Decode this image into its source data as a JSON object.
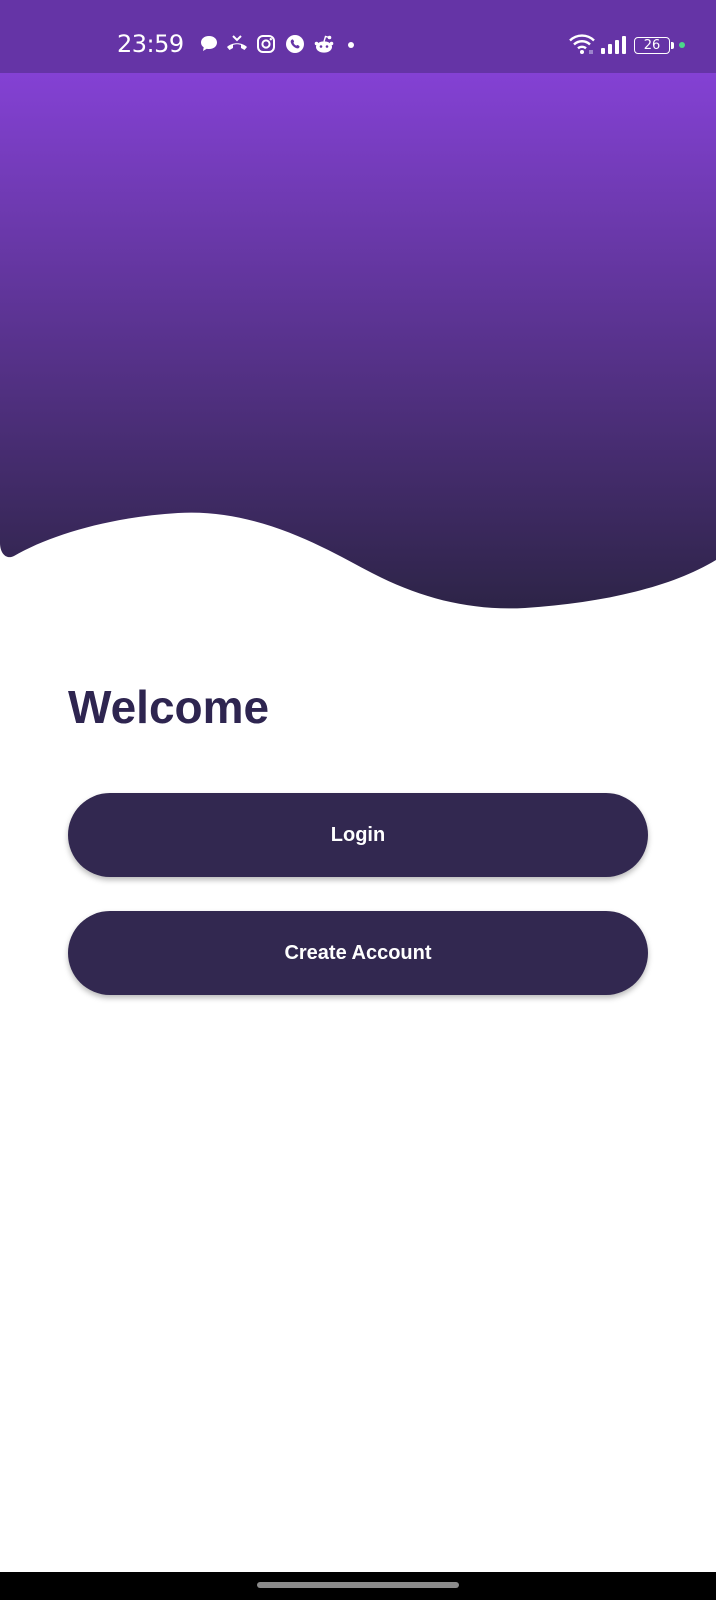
{
  "status_bar": {
    "time": "23:59",
    "battery_level": "26",
    "notification_icons": [
      "chat-bubble-icon",
      "missed-call-icon",
      "instagram-icon",
      "viber-icon",
      "reddit-icon",
      "more-dot-icon"
    ],
    "system_icons": [
      "wifi-icon",
      "signal-icon",
      "battery-icon",
      "charging-dot-icon"
    ]
  },
  "header": {
    "gradient_top": "#8441d4",
    "gradient_bottom": "#2d2447"
  },
  "main": {
    "title": "Welcome",
    "login_label": "Login",
    "create_account_label": "Create Account"
  },
  "colors": {
    "status_bar": "#6534a6",
    "button": "#322850",
    "title": "#2e2550",
    "charging_dot": "#4cd88a"
  }
}
